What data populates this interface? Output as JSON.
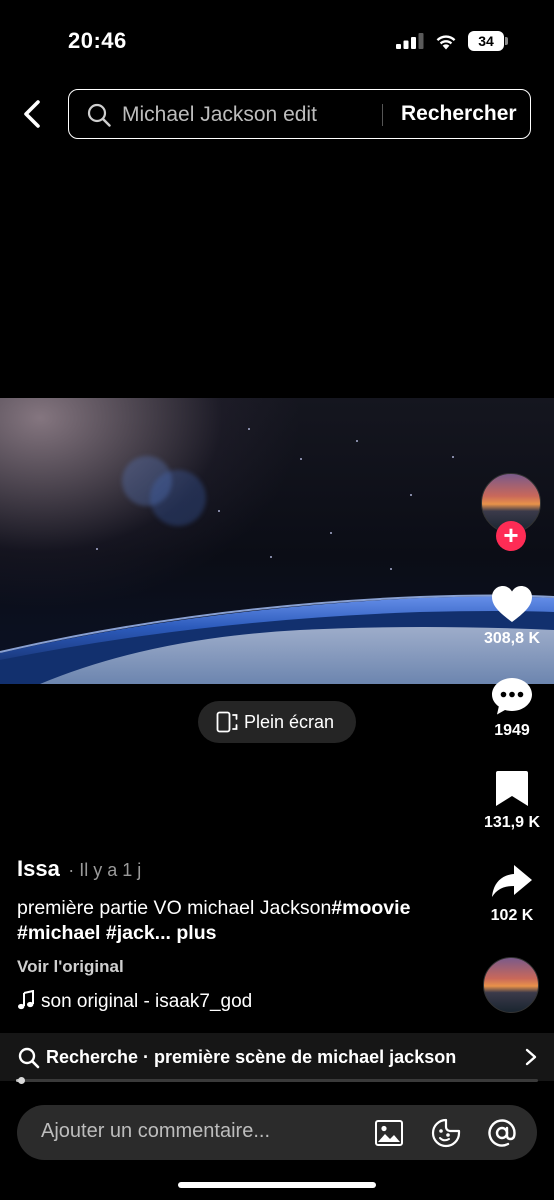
{
  "status_bar": {
    "time": "20:46",
    "battery_level": "34"
  },
  "search": {
    "query": "Michael Jackson edit",
    "submit_label": "Rechercher"
  },
  "player": {
    "fullscreen_label": "Plein écran",
    "progress": 0.01
  },
  "actions": {
    "likes": "308,8 K",
    "comments": "1949",
    "saves": "131,9 K",
    "shares": "102 K"
  },
  "post": {
    "author": "Issa",
    "age": "· Il y a 1 j",
    "caption_text": "première partie VO michael Jackson",
    "caption_hashtags": "#moovie #michael #jack...",
    "more_label": "plus",
    "see_original": "Voir l'original",
    "sound": "son original - isaak7_god"
  },
  "related_search": {
    "label": "Recherche · première scène de michael jackson"
  },
  "comment_bar": {
    "placeholder": "Ajouter un commentaire..."
  },
  "icons": [
    "back-icon",
    "search-icon",
    "fullscreen-icon",
    "plus-icon",
    "heart-icon",
    "comment-icon",
    "bookmark-icon",
    "share-icon",
    "music-note-icon",
    "chevron-right-icon",
    "image-icon",
    "emoji-icon",
    "mention-icon"
  ],
  "colors": {
    "accent": "#fe2c55",
    "background": "#000000",
    "surface": "#2b2b2b"
  }
}
